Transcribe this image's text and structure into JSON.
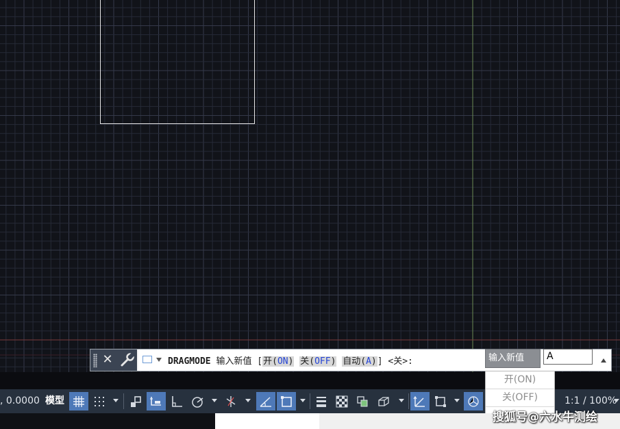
{
  "command_line": {
    "command": "DRAGMODE",
    "prompt_text": "输入新值",
    "bracket_open": "[",
    "bracket_close": "]",
    "options": [
      {
        "label": "开(",
        "key": "ON",
        "close": ")"
      },
      {
        "label": "关(",
        "key": "OFF",
        "close": ")"
      },
      {
        "label": "自动(",
        "key": "A",
        "close": ")"
      }
    ],
    "default_text": "<关>:",
    "dynamic_prompt_label": "输入新值",
    "dynamic_input_value": "A"
  },
  "dropdown": {
    "items": [
      "开(ON)",
      "关(OFF)"
    ]
  },
  "statusbar": {
    "coordinates": ", 0.0000",
    "model_tab": "模型",
    "scale": "1:1 / 100%"
  },
  "watermark": "搜狐号@六水牛测绘",
  "colors": {
    "canvas_bg": "#111319",
    "grid_minor": "#262a37",
    "grid_major": "#353a4a",
    "y_axis": "#6a8a52",
    "x_axis": "#7a3a3a",
    "status_active": "#4e79b8",
    "option_key": "#2444d6"
  },
  "icons": [
    "close-icon",
    "wrench-icon",
    "command-icon",
    "grid-icon",
    "snap-icon",
    "infer-constraints-icon",
    "dynamic-ucs-icon",
    "ortho-icon",
    "polar-icon",
    "isodraft-icon",
    "osnap-tracking-icon",
    "osnap-icon",
    "lineweight-icon",
    "transparency-icon",
    "selection-cycling-icon",
    "3d-osnap-icon",
    "dynamic-input-icon",
    "gizmo-icon",
    "annotation-scale-icon"
  ]
}
